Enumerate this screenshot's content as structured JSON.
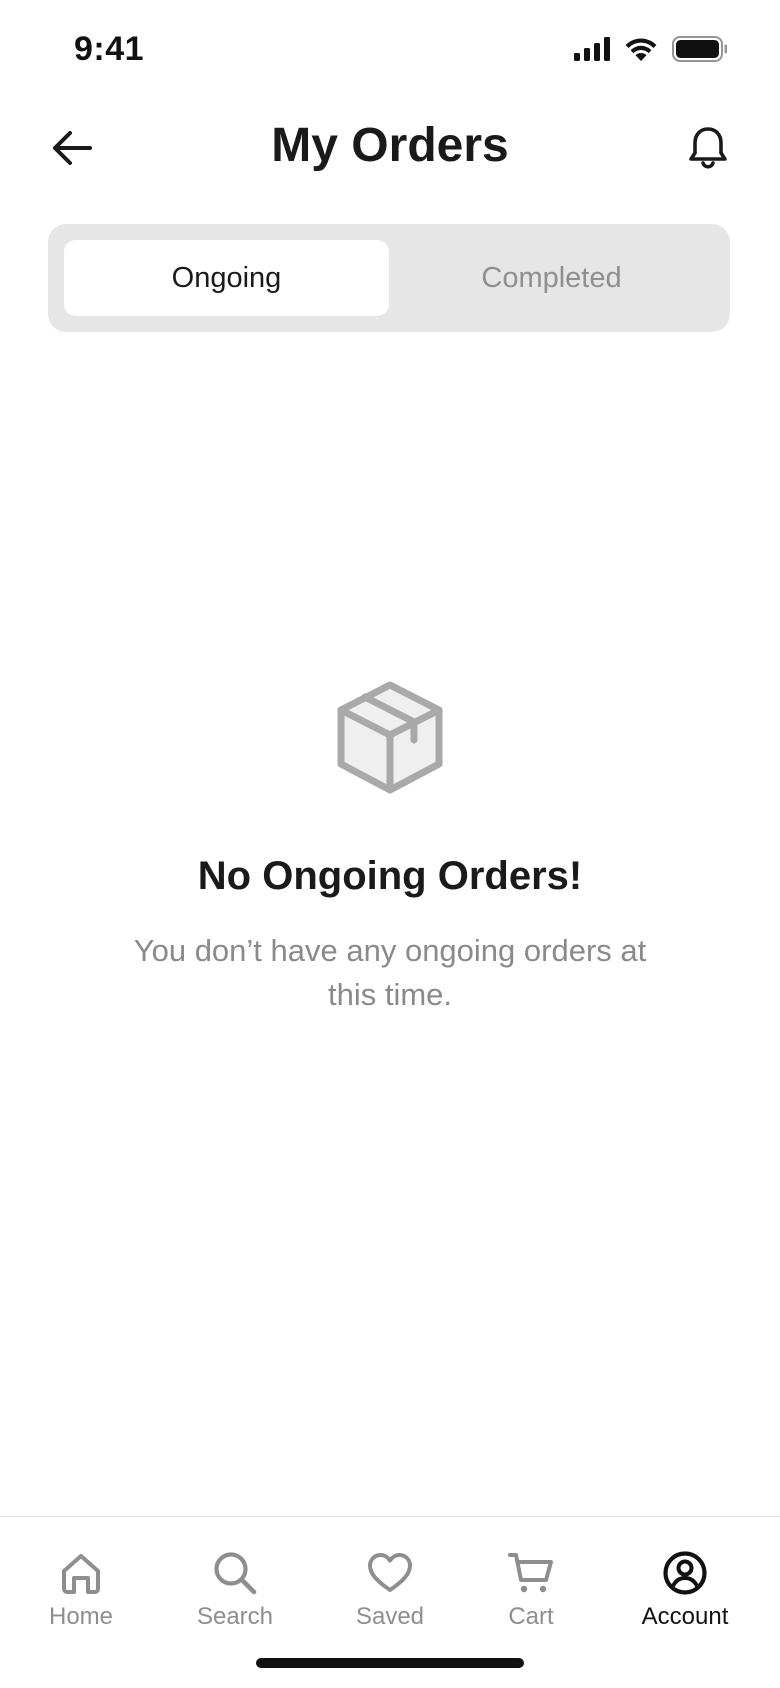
{
  "status_bar": {
    "time": "9:41"
  },
  "header": {
    "title": "My Orders"
  },
  "tabs": [
    {
      "label": "Ongoing",
      "active": true
    },
    {
      "label": "Completed",
      "active": false
    }
  ],
  "empty_state": {
    "icon": "package-icon",
    "title": "No Ongoing Orders!",
    "subtitle": "You don’t have any ongoing orders at this time."
  },
  "bottom_nav": [
    {
      "label": "Home",
      "icon": "home-icon",
      "active": false
    },
    {
      "label": "Search",
      "icon": "search-icon",
      "active": false
    },
    {
      "label": "Saved",
      "icon": "heart-icon",
      "active": false
    },
    {
      "label": "Cart",
      "icon": "cart-icon",
      "active": false
    },
    {
      "label": "Account",
      "icon": "account-icon",
      "active": true
    }
  ],
  "colors": {
    "text_primary": "#1a1a1a",
    "text_muted": "#8e8e8e",
    "segment_bg": "#e6e6e6",
    "icon_gray": "#a9a9a9"
  }
}
